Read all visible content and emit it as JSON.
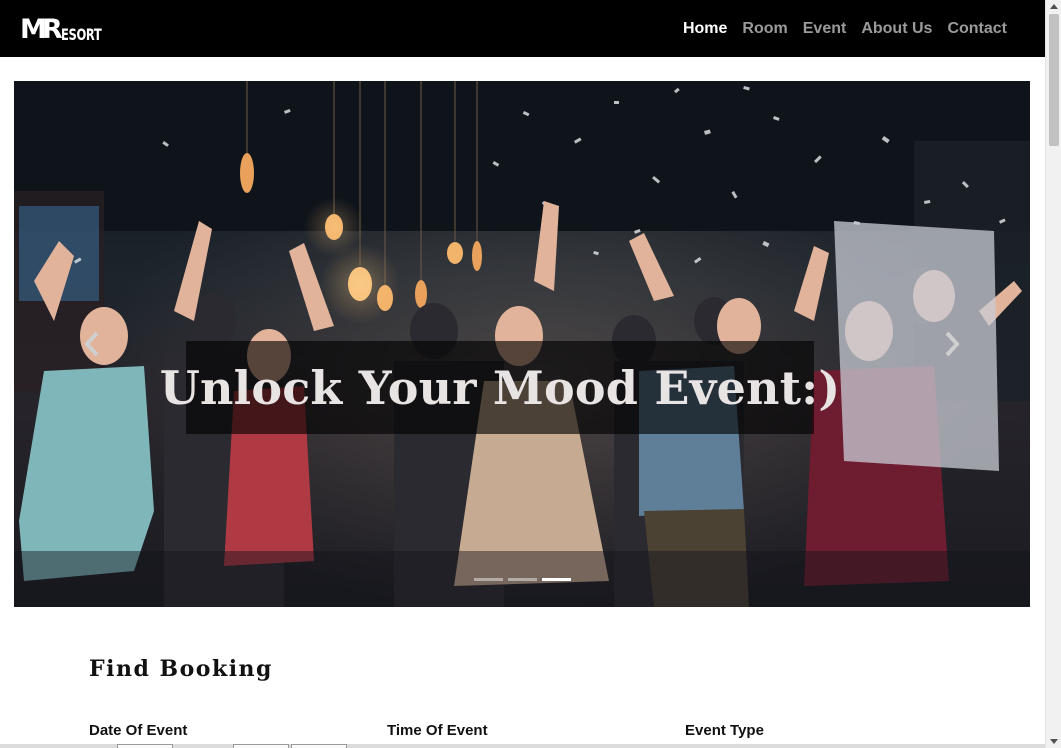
{
  "brand": {
    "logo_big": "MR",
    "logo_small": "ESORT"
  },
  "nav": {
    "items": [
      {
        "label": "Home",
        "active": true
      },
      {
        "label": "Room",
        "active": false
      },
      {
        "label": "Event",
        "active": false
      },
      {
        "label": "About Us",
        "active": false
      },
      {
        "label": "Contact",
        "active": false
      }
    ]
  },
  "carousel": {
    "caption": "Unlock Your Mood Event:)",
    "prev_icon": "chevron-left-icon",
    "next_icon": "chevron-right-icon",
    "slide_count": 3,
    "active_slide": 3
  },
  "booking": {
    "title": "Find Booking",
    "fields": [
      {
        "label": "Date Of Event"
      },
      {
        "label": "Time Of Event"
      },
      {
        "label": "Event Type"
      }
    ]
  },
  "colors": {
    "navbar": "#000000",
    "nav_active": "#ffffff",
    "nav_inactive": "#9a9a9a",
    "caption_bg": "rgba(0,0,0,0.62)"
  }
}
